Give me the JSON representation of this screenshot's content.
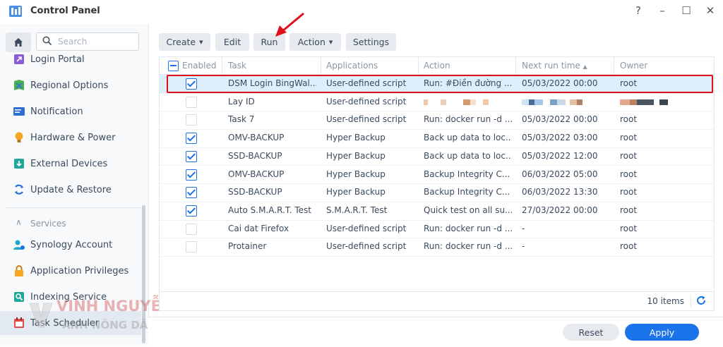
{
  "window": {
    "title": "Control Panel",
    "controls": [
      "?",
      "–",
      "☐",
      "✕"
    ]
  },
  "sidebar": {
    "search_placeholder": "Search",
    "items": [
      {
        "label": "Login Portal",
        "icon": "login-portal-icon"
      },
      {
        "label": "Regional Options",
        "icon": "regional-options-icon"
      },
      {
        "label": "Notification",
        "icon": "notification-icon"
      },
      {
        "label": "Hardware & Power",
        "icon": "hardware-power-icon"
      },
      {
        "label": "External Devices",
        "icon": "external-devices-icon"
      },
      {
        "label": "Update & Restore",
        "icon": "update-restore-icon"
      }
    ],
    "section_services": "Services",
    "services": [
      {
        "label": "Synology Account",
        "icon": "synology-account-icon"
      },
      {
        "label": "Application Privileges",
        "icon": "application-privileges-icon"
      },
      {
        "label": "Indexing Service",
        "icon": "indexing-service-icon"
      },
      {
        "label": "Task Scheduler",
        "icon": "task-scheduler-icon",
        "active": true
      }
    ]
  },
  "toolbar": {
    "create": "Create",
    "edit": "Edit",
    "run": "Run",
    "action": "Action",
    "settings": "Settings"
  },
  "grid": {
    "headers": {
      "enabled": "Enabled",
      "task": "Task",
      "applications": "Applications",
      "action": "Action",
      "next_run": "Next run time",
      "owner": "Owner"
    },
    "rows": [
      {
        "enabled": true,
        "task": "DSM Login BingWal...",
        "app": "User-defined script",
        "action": "Run: #Điền đường ...",
        "next": "05/03/2022 00:00",
        "owner": "root",
        "selected": true
      },
      {
        "enabled": false,
        "task": "Lay ID",
        "app": "User-defined script",
        "action": "",
        "next": "",
        "owner": "",
        "redacted": true
      },
      {
        "enabled": false,
        "task": "Task 7",
        "app": "User-defined script",
        "action": "Run: docker run -d ...",
        "next": "05/03/2022 00:00",
        "owner": "root"
      },
      {
        "enabled": true,
        "task": "OMV-BACKUP",
        "app": "Hyper Backup",
        "action": "Back up data to loc...",
        "next": "05/03/2022 03:00",
        "owner": "root"
      },
      {
        "enabled": true,
        "task": "SSD-BACKUP",
        "app": "Hyper Backup",
        "action": "Back up data to loc...",
        "next": "05/03/2022 12:00",
        "owner": "root"
      },
      {
        "enabled": true,
        "task": "OMV-BACKUP",
        "app": "Hyper Backup",
        "action": "Backup Integrity C...",
        "next": "06/03/2022 05:00",
        "owner": "root"
      },
      {
        "enabled": true,
        "task": "SSD-BACKUP",
        "app": "Hyper Backup",
        "action": "Backup Integrity C...",
        "next": "06/03/2022 13:30",
        "owner": "root"
      },
      {
        "enabled": true,
        "task": "Auto S.M.A.R.T. Test",
        "app": "S.M.A.R.T. Test",
        "action": "Quick test on all su...",
        "next": "27/03/2022 00:00",
        "owner": "root"
      },
      {
        "enabled": false,
        "task": "Cai dat Firefox",
        "app": "User-defined script",
        "action": "Run: docker run -d ...",
        "next": "-",
        "owner": "root"
      },
      {
        "enabled": false,
        "task": "Protainer",
        "app": "User-defined script",
        "action": "Run: docker run -d ...",
        "next": "-",
        "owner": "root"
      }
    ],
    "footer_count": "10 items"
  },
  "buttons": {
    "reset": "Reset",
    "apply": "Apply"
  },
  "watermark": {
    "line1": "VINH NGUYỄN",
    "line2": "ANH NÔNG DÂN IT"
  },
  "colors": {
    "accent": "#1a73e8",
    "highlight": "#e0101a",
    "selected_row": "#dfeefb"
  }
}
